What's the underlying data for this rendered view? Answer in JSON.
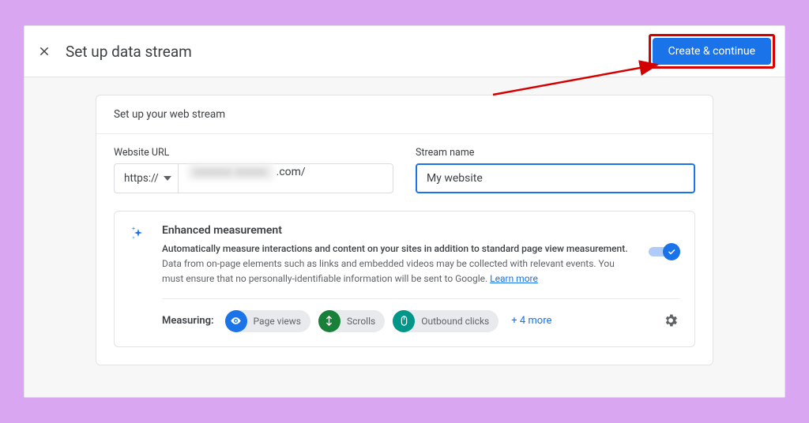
{
  "titlebar": {
    "title": "Set up data stream",
    "primary_button": "Create & continue"
  },
  "card": {
    "heading": "Set up your web stream",
    "url_label": "Website URL",
    "protocol": "https://",
    "url_suffix": ".com/",
    "stream_label": "Stream name",
    "stream_value": "My website"
  },
  "enhanced": {
    "title": "Enhanced measurement",
    "desc_bold": "Automatically measure interactions and content on your sites in addition to standard page view measurement.",
    "desc_rest": "Data from on-page elements such as links and embedded videos may be collected with relevant events. You must ensure that no personally-identifiable information will be sent to Google. ",
    "learn_more": "Learn more",
    "toggle_on": true,
    "measuring_label": "Measuring:",
    "chips": [
      "Page views",
      "Scrolls",
      "Outbound clicks"
    ],
    "more": "+ 4 more"
  }
}
